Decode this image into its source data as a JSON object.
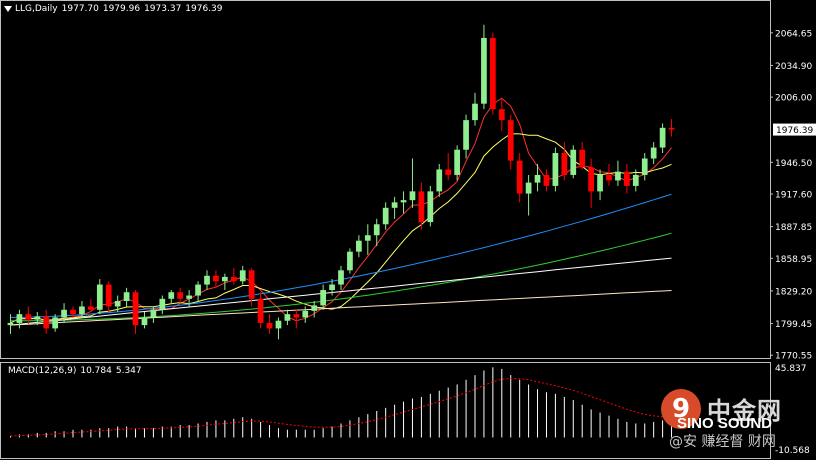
{
  "header": {
    "symbol_tf": "LLG,Daily",
    "open": "1977.70",
    "high": "1979.96",
    "low": "1973.37",
    "close": "1976.39"
  },
  "macd_header": {
    "label": "MACD(12,26,9)",
    "macd": "10.784",
    "signal": "5.347"
  },
  "watermark": {
    "cn": "中金网",
    "en": "SINO SOUND",
    "sub": "@安 赚经督 财网"
  },
  "colors": {
    "bg": "#000000",
    "bull": "#90ee90",
    "bear": "#ff0000",
    "ma5": "#ff3030",
    "ma10": "#ffff66",
    "ma30": "#1e90ff",
    "ma60": "#32cd32",
    "ma120": "#ffffff",
    "ma250": "#ffe4c4",
    "axis": "#c0c0c0",
    "macd_hist": "#ffffff",
    "macd_signal": "#ff0000",
    "price_box": "#ffffff"
  },
  "chart_data": [
    {
      "type": "candlestick",
      "title": "LLG,Daily",
      "y_ticks": [
        "2064.65",
        "2034.90",
        "2006.00",
        "1976.39",
        "1946.50",
        "1917.60",
        "1887.85",
        "1858.95",
        "1829.20",
        "1799.45",
        "1770.55"
      ],
      "ylim": [
        1768,
        2080
      ],
      "current_price": "1976.39",
      "ohlc": [
        [
          1798,
          1808,
          1790,
          1800
        ],
        [
          1800,
          1812,
          1795,
          1808
        ],
        [
          1808,
          1815,
          1799,
          1803
        ],
        [
          1803,
          1810,
          1798,
          1806
        ],
        [
          1806,
          1812,
          1790,
          1795
        ],
        [
          1795,
          1808,
          1792,
          1805
        ],
        [
          1805,
          1818,
          1800,
          1812
        ],
        [
          1812,
          1815,
          1805,
          1808
        ],
        [
          1808,
          1820,
          1805,
          1815
        ],
        [
          1815,
          1822,
          1810,
          1812
        ],
        [
          1812,
          1840,
          1808,
          1835
        ],
        [
          1835,
          1838,
          1810,
          1815
        ],
        [
          1815,
          1825,
          1810,
          1820
        ],
        [
          1820,
          1832,
          1815,
          1828
        ],
        [
          1828,
          1830,
          1790,
          1798
        ],
        [
          1798,
          1810,
          1795,
          1805
        ],
        [
          1805,
          1815,
          1800,
          1812
        ],
        [
          1812,
          1825,
          1808,
          1822
        ],
        [
          1822,
          1830,
          1818,
          1828
        ],
        [
          1828,
          1832,
          1818,
          1822
        ],
        [
          1822,
          1830,
          1815,
          1825
        ],
        [
          1825,
          1838,
          1820,
          1835
        ],
        [
          1835,
          1848,
          1830,
          1843
        ],
        [
          1843,
          1848,
          1832,
          1838
        ],
        [
          1838,
          1845,
          1830,
          1842
        ],
        [
          1842,
          1850,
          1835,
          1838
        ],
        [
          1838,
          1852,
          1835,
          1848
        ],
        [
          1848,
          1850,
          1815,
          1822
        ],
        [
          1822,
          1828,
          1795,
          1800
        ],
        [
          1800,
          1808,
          1790,
          1795
        ],
        [
          1795,
          1805,
          1785,
          1802
        ],
        [
          1802,
          1812,
          1798,
          1808
        ],
        [
          1808,
          1812,
          1795,
          1805
        ],
        [
          1805,
          1815,
          1800,
          1811
        ],
        [
          1811,
          1820,
          1805,
          1816
        ],
        [
          1816,
          1835,
          1812,
          1830
        ],
        [
          1830,
          1840,
          1825,
          1835
        ],
        [
          1835,
          1852,
          1830,
          1848
        ],
        [
          1848,
          1868,
          1845,
          1865
        ],
        [
          1865,
          1880,
          1860,
          1875
        ],
        [
          1875,
          1890,
          1862,
          1880
        ],
        [
          1880,
          1895,
          1870,
          1890
        ],
        [
          1890,
          1910,
          1885,
          1905
        ],
        [
          1905,
          1915,
          1895,
          1910
        ],
        [
          1910,
          1920,
          1900,
          1912
        ],
        [
          1912,
          1950,
          1905,
          1920
        ],
        [
          1920,
          1928,
          1885,
          1892
        ],
        [
          1892,
          1925,
          1888,
          1920
        ],
        [
          1920,
          1945,
          1915,
          1940
        ],
        [
          1940,
          1955,
          1930,
          1935
        ],
        [
          1935,
          1962,
          1930,
          1958
        ],
        [
          1958,
          1990,
          1950,
          1985
        ],
        [
          1985,
          2010,
          1980,
          2000
        ],
        [
          2000,
          2072,
          1995,
          2060
        ],
        [
          2060,
          2065,
          1990,
          1995
        ],
        [
          1995,
          2005,
          1975,
          1985
        ],
        [
          1985,
          1990,
          1940,
          1948
        ],
        [
          1948,
          1955,
          1910,
          1918
        ],
        [
          1918,
          1935,
          1898,
          1928
        ],
        [
          1928,
          1945,
          1920,
          1935
        ],
        [
          1935,
          1940,
          1920,
          1925
        ],
        [
          1925,
          1960,
          1920,
          1955
        ],
        [
          1955,
          1965,
          1930,
          1935
        ],
        [
          1935,
          1962,
          1932,
          1958
        ],
        [
          1958,
          1965,
          1940,
          1942
        ],
        [
          1942,
          1950,
          1905,
          1920
        ],
        [
          1920,
          1940,
          1912,
          1935
        ],
        [
          1935,
          1945,
          1925,
          1930
        ],
        [
          1930,
          1948,
          1925,
          1938
        ],
        [
          1938,
          1945,
          1918,
          1925
        ],
        [
          1925,
          1940,
          1920,
          1935
        ],
        [
          1935,
          1955,
          1930,
          1950
        ],
        [
          1950,
          1965,
          1945,
          1960
        ],
        [
          1960,
          1982,
          1955,
          1978
        ],
        [
          1978,
          1986,
          1970,
          1976.39
        ]
      ],
      "ma_periods": [
        5,
        10,
        30,
        60,
        120,
        250
      ]
    },
    {
      "type": "macd",
      "title": "MACD(12,26,9)",
      "macd_value": 10.784,
      "signal_value": 5.347,
      "y_ticks": [
        "45.837",
        "-10.568"
      ],
      "ylim": [
        -10.568,
        45.837
      ],
      "histogram": [
        1,
        2,
        2,
        3,
        3,
        4,
        4,
        5,
        5,
        5,
        6,
        6,
        7,
        7,
        6,
        6,
        6,
        7,
        7,
        8,
        8,
        9,
        10,
        11,
        11,
        12,
        13,
        12,
        10,
        8,
        6,
        5,
        5,
        5,
        5,
        6,
        7,
        9,
        11,
        13,
        15,
        17,
        19,
        21,
        23,
        25,
        26,
        28,
        30,
        32,
        34,
        37,
        40,
        43,
        45,
        44,
        40,
        37,
        34,
        31,
        29,
        28,
        26,
        24,
        21,
        18,
        16,
        14,
        12,
        10,
        9,
        9,
        10,
        11,
        11
      ]
    }
  ]
}
